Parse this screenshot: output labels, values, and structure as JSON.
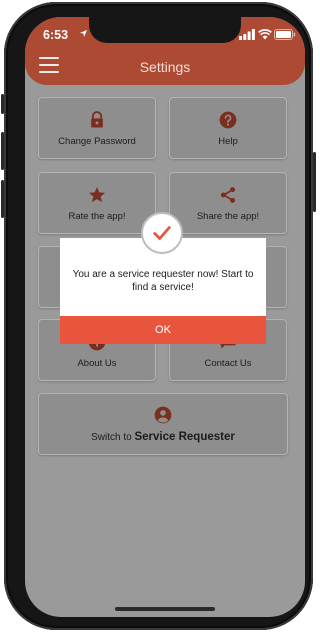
{
  "status_bar": {
    "time": "6:53"
  },
  "header": {
    "title": "Settings"
  },
  "tiles": {
    "change_password": "Change Password",
    "help": "Help",
    "rate_app": "Rate the app!",
    "share_app": "Share the app!",
    "about_us": "About Us",
    "contact_us": "Contact Us",
    "switch_prefix": "Switch to",
    "switch_target": "Service Requester"
  },
  "dialog": {
    "message": "You are a service requester now! Start to find a service!",
    "ok_label": "OK"
  },
  "colors": {
    "header": "#ad4a34",
    "accent": "#e9553c",
    "overlay_background": "#9a9a9a",
    "tile_icon": "#7a2e20"
  },
  "icons": {
    "change_password": "lock-icon",
    "help": "help-circle-icon",
    "rate_app": "star-icon",
    "share_app": "share-icon",
    "about_us": "info-icon",
    "contact_us": "chat-icon",
    "switch": "account-circle-icon",
    "dialog_badge": "check-icon"
  }
}
